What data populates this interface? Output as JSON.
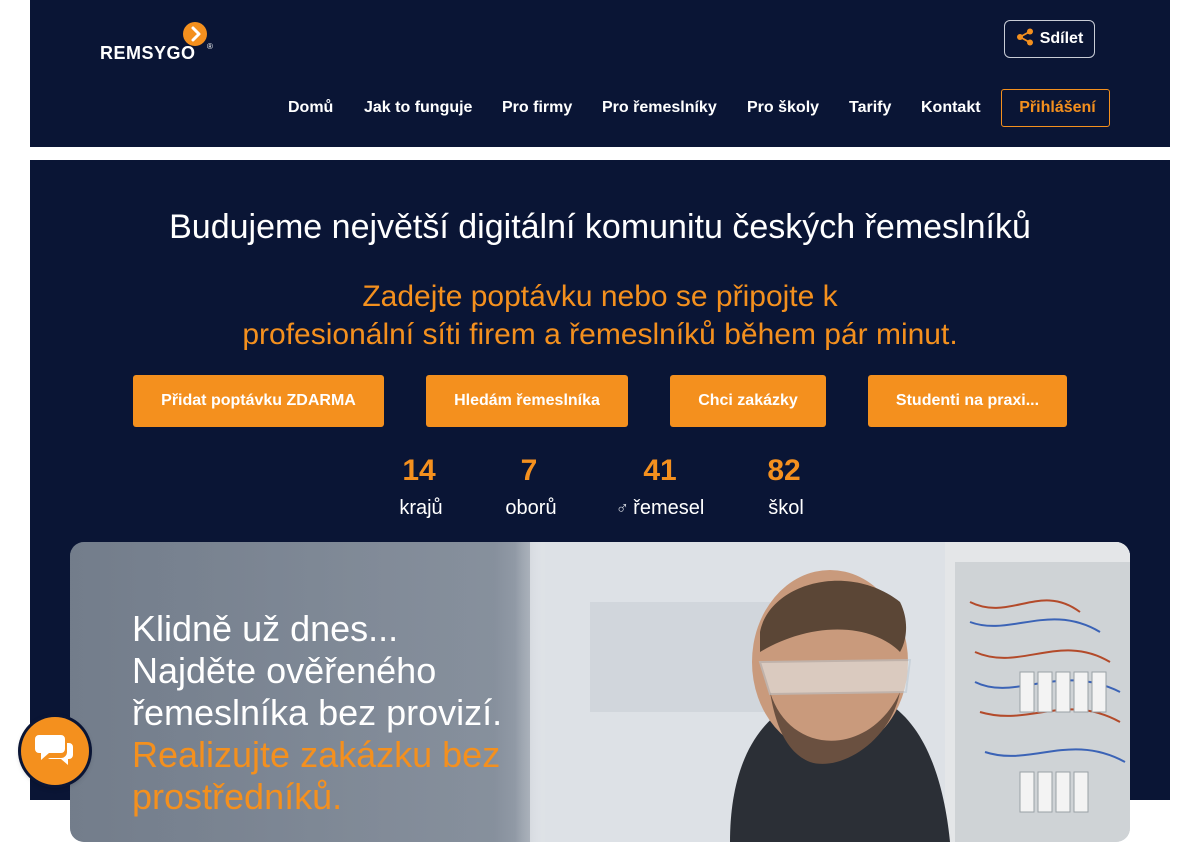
{
  "brand": {
    "logo_text": "REMSYGO",
    "logo_reg": "®",
    "accent_color": "#f4901e",
    "dark_color": "#0a1535"
  },
  "header": {
    "share_label": "Sdílet",
    "share_icon": "share-icon",
    "nav": [
      {
        "label": "Domů"
      },
      {
        "label": "Jak to funguje"
      },
      {
        "label": "Pro firmy"
      },
      {
        "label": "Pro řemeslníky"
      },
      {
        "label": "Pro školy"
      },
      {
        "label": "Tarify"
      },
      {
        "label": "Kontakt"
      }
    ],
    "login_label": "Přihlášení",
    "login_icon": "login-icon"
  },
  "hero": {
    "title": "Budujeme největší digitální komunitu českých řemeslníků",
    "subtitle_line1": "Zadejte poptávku nebo se připojte k",
    "subtitle_line2": "profesionální síti firem a řemeslníků během pár minut.",
    "buttons": [
      {
        "label": "Přidat poptávku ZDARMA"
      },
      {
        "label": "Hledám řemeslníka"
      },
      {
        "label": "Chci zakázky"
      },
      {
        "label": "Studenti na praxi..."
      }
    ],
    "stats": [
      {
        "value": "14",
        "label": "krajů",
        "icon": "map-icon"
      },
      {
        "value": "7",
        "label": "oborů",
        "icon": "briefcase-icon"
      },
      {
        "value": "41",
        "label": "řemesel",
        "icon": "worker-icon",
        "glyph_suffix": "♂"
      },
      {
        "value": "82",
        "label": "škol",
        "icon": "school-icon"
      }
    ]
  },
  "card": {
    "line1": "Klidně už dnes...",
    "line2": "Najděte ověřeného",
    "line3": "řemeslníka bez provizí.",
    "line4": "Realizujte zakázku bez",
    "line5": "prostředníků."
  },
  "chat": {
    "icon": "chat-icon"
  }
}
